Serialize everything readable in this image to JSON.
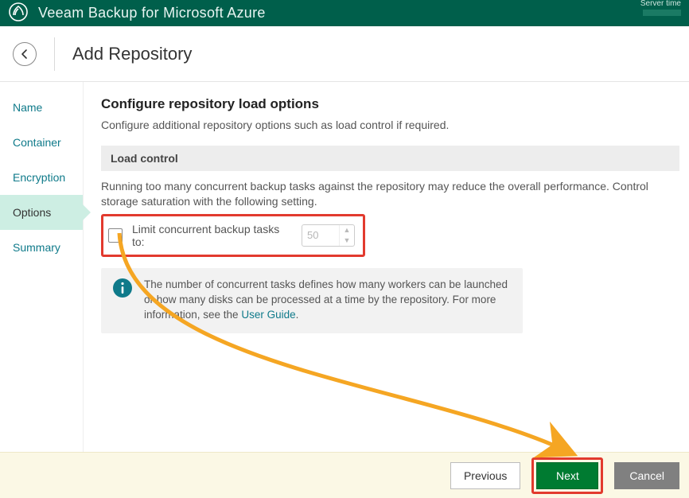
{
  "app": {
    "title": "Veeam Backup for Microsoft Azure",
    "server_time_label": "Server time"
  },
  "header": {
    "page_title": "Add Repository"
  },
  "sidebar": {
    "items": [
      {
        "label": "Name",
        "active": false
      },
      {
        "label": "Container",
        "active": false
      },
      {
        "label": "Encryption",
        "active": false
      },
      {
        "label": "Options",
        "active": true
      },
      {
        "label": "Summary",
        "active": false
      }
    ]
  },
  "content": {
    "heading": "Configure repository load options",
    "description": "Configure additional repository options such as load control if required.",
    "section_title": "Load control",
    "section_desc": "Running too many concurrent backup tasks against the repository may reduce the overall performance. Control storage saturation with the following setting.",
    "limit_label": "Limit concurrent backup tasks to:",
    "limit_value": "50",
    "info_text_pre": "The number of concurrent tasks defines how many workers can be launched or how many disks can be processed at a time by the repository. For more information, see the ",
    "info_text_link": "User Guide",
    "info_text_post": "."
  },
  "footer": {
    "previous": "Previous",
    "next": "Next",
    "cancel": "Cancel"
  },
  "annotation": {
    "highlight_color": "#e23a2e",
    "arrow_color": "#f5a623"
  }
}
